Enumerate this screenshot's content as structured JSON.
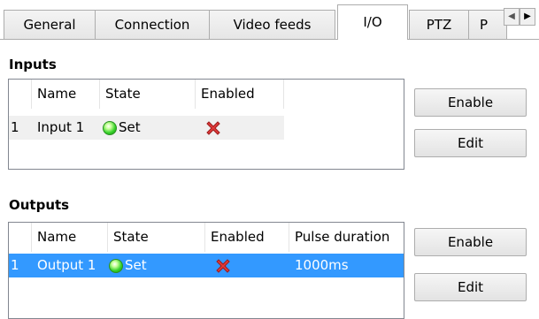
{
  "tabs": [
    {
      "label": "General",
      "active": false
    },
    {
      "label": "Connection",
      "active": false
    },
    {
      "label": "Video feeds",
      "active": false
    },
    {
      "label": "I/O",
      "active": true
    },
    {
      "label": "PTZ",
      "active": false
    },
    {
      "label": "P",
      "active": false
    }
  ],
  "inputs": {
    "title": "Inputs",
    "columns": [
      "",
      "Name",
      "State",
      "Enabled",
      ""
    ],
    "rows": [
      {
        "index": "1",
        "name": "Input 1",
        "state": "Set",
        "enabled_icon": "red-x-icon"
      }
    ],
    "enable_label": "Enable",
    "edit_label": "Edit"
  },
  "outputs": {
    "title": "Outputs",
    "columns": [
      "",
      "Name",
      "State",
      "Enabled",
      "Pulse duration"
    ],
    "rows": [
      {
        "index": "1",
        "name": "Output 1",
        "state": "Set",
        "enabled_icon": "red-x-icon",
        "pulse": "1000ms"
      }
    ],
    "enable_label": "Enable",
    "edit_label": "Edit"
  },
  "icons": {
    "state_led": "green-led-icon",
    "scroll_left": "arrow-left-icon",
    "scroll_right": "arrow-right-icon"
  },
  "colors": {
    "selection": "#3399ff",
    "led_green": "#36d22a",
    "x_red": "#e03a3a"
  }
}
